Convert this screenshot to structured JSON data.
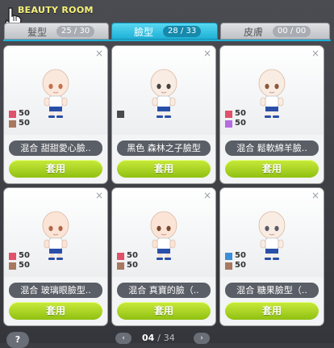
{
  "window": {
    "title": "BEAUTY ROOM"
  },
  "tabs": [
    {
      "label": "髮型",
      "count": "25 / 30",
      "active": false
    },
    {
      "label": "臉型",
      "count": "28 / 33",
      "active": true
    },
    {
      "label": "皮膚",
      "count": "00 / 00",
      "active": false
    }
  ],
  "cards": [
    {
      "name": "混合 甜甜愛心臉..",
      "mix": [
        {
          "color": "#e0516b",
          "pct": "50"
        },
        {
          "color": "#a87860",
          "pct": "50"
        }
      ],
      "apply": "套用",
      "eye": "#c8704e",
      "skin": "#fbe8dc"
    },
    {
      "name": "黑色 森林之子臉型",
      "mix": [
        {
          "color": "#4a4a4a",
          "pct": ""
        }
      ],
      "apply": "套用",
      "eye": "#444444",
      "skin": "#f9ece2"
    },
    {
      "name": "混合 鬆軟綿羊臉..",
      "mix": [
        {
          "color": "#e0516b",
          "pct": "50"
        },
        {
          "color": "#b46ce0",
          "pct": "50"
        }
      ],
      "apply": "套用",
      "eye": "#8a5a3c",
      "skin": "#f9ece2"
    },
    {
      "name": "混合 玻璃眼臉型..",
      "mix": [
        {
          "color": "#e0516b",
          "pct": "50"
        },
        {
          "color": "#a87860",
          "pct": "50"
        }
      ],
      "apply": "套用",
      "eye": "#b0684a",
      "skin": "#fbe4d6"
    },
    {
      "name": "混合 真寶的臉（..",
      "mix": [
        {
          "color": "#e0516b",
          "pct": "50"
        },
        {
          "color": "#a87860",
          "pct": "50"
        }
      ],
      "apply": "套用",
      "eye": "#7a4a30",
      "skin": "#fbe4d6"
    },
    {
      "name": "混合 糖果臉型（..",
      "mix": [
        {
          "color": "#3a8fd8",
          "pct": "50"
        },
        {
          "color": "#a87860",
          "pct": "50"
        }
      ],
      "apply": "套用",
      "eye": "#5a5a6a",
      "skin": "#f9ece2"
    }
  ],
  "pagination": {
    "current": "04",
    "separator": "/",
    "total": "34",
    "prev": "‹",
    "next": "›"
  },
  "help": {
    "label": "?"
  },
  "icons": {
    "close": "×"
  }
}
